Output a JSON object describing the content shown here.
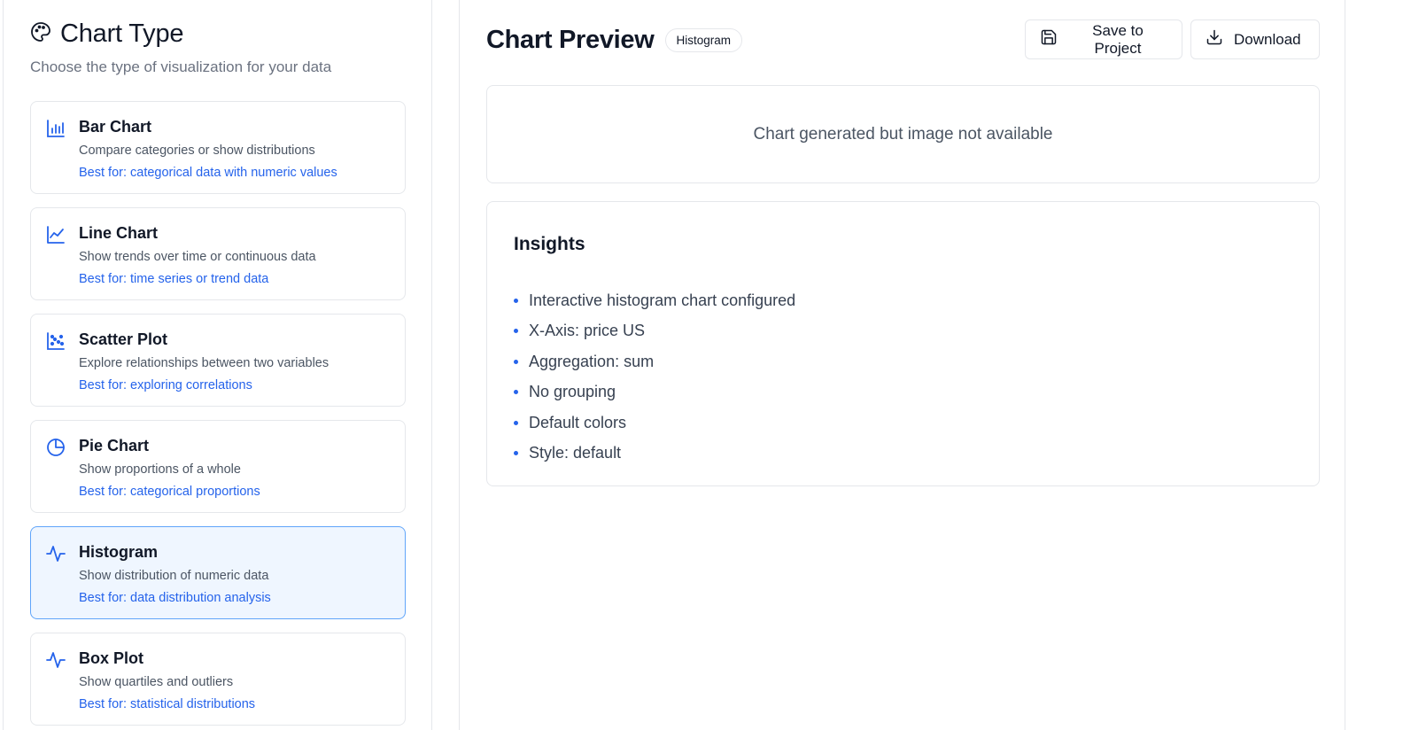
{
  "left": {
    "title": "Chart Type",
    "subtitle": "Choose the type of visualization for your data",
    "chart_types": [
      {
        "title": "Bar Chart",
        "desc": "Compare categories or show distributions",
        "best": "Best for: categorical data with numeric values",
        "icon": "bar-chart-icon",
        "selected": false
      },
      {
        "title": "Line Chart",
        "desc": "Show trends over time or continuous data",
        "best": "Best for: time series or trend data",
        "icon": "line-chart-icon",
        "selected": false
      },
      {
        "title": "Scatter Plot",
        "desc": "Explore relationships between two variables",
        "best": "Best for: exploring correlations",
        "icon": "scatter-plot-icon",
        "selected": false
      },
      {
        "title": "Pie Chart",
        "desc": "Show proportions of a whole",
        "best": "Best for: categorical proportions",
        "icon": "pie-chart-icon",
        "selected": false
      },
      {
        "title": "Histogram",
        "desc": "Show distribution of numeric data",
        "best": "Best for: data distribution analysis",
        "icon": "activity-icon",
        "selected": true
      },
      {
        "title": "Box Plot",
        "desc": "Show quartiles and outliers",
        "best": "Best for: statistical distributions",
        "icon": "activity-icon",
        "selected": false
      }
    ]
  },
  "right": {
    "title": "Chart Preview",
    "badge": "Histogram",
    "save_label": "Save to Project",
    "download_label": "Download",
    "image_message": "Chart generated but image not available",
    "insights_title": "Insights",
    "insights": [
      "Interactive histogram chart configured",
      "X-Axis: price US",
      "Aggregation: sum",
      "No grouping",
      "Default colors",
      "Style: default"
    ]
  },
  "colors": {
    "accent": "#2563eb",
    "selected_bg": "#eff6ff",
    "selected_border": "#60a5fa",
    "border": "#e5e7eb"
  }
}
